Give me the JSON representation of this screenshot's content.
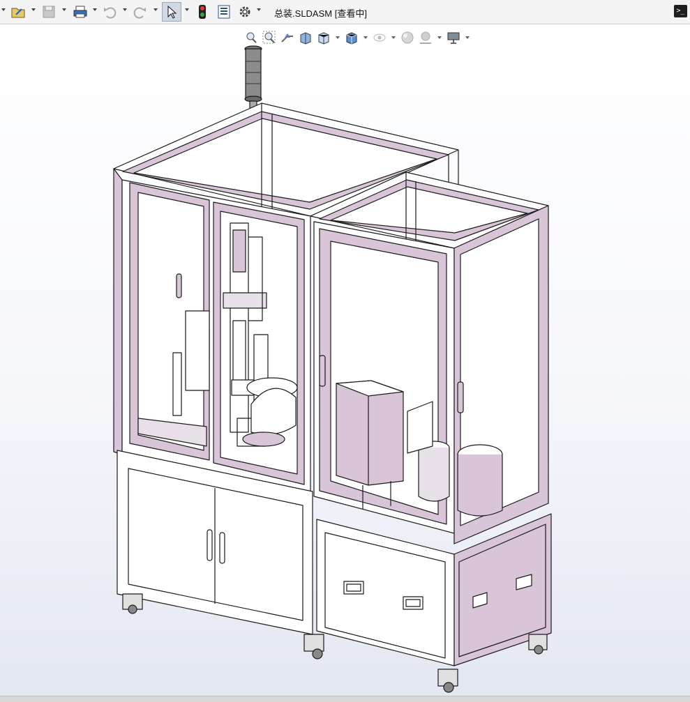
{
  "window": {
    "title": "总装.SLDASM [查看中]"
  },
  "toolbar": {
    "icons": [
      "menu-caret-icon",
      "open-icon",
      "save-icon",
      "print-icon",
      "undo-icon",
      "redo-icon",
      "select-arrow-icon",
      "traffic-light-icon",
      "options-list-icon",
      "gear-icon"
    ],
    "command_glyph": ">_"
  },
  "heads_up": {
    "icons": [
      "zoom-to-fit-icon",
      "zoom-to-area-icon",
      "previous-view-icon",
      "section-view-icon",
      "view-orientation-icon",
      "display-style-icon",
      "hide-show-icon",
      "appearance-icon",
      "scene-icon",
      "display-monitor-icon"
    ]
  },
  "colors": {
    "panel_fill": "#d8c6d8",
    "line": "#1a1a1a",
    "toolbar_bg": "#f4f4f4",
    "select_highlight": "#cfd8e3",
    "beacon": "#6a6a6a"
  },
  "model": {
    "name": "总装",
    "components": [
      "left-cabinet",
      "right-cabinet",
      "signal-tower",
      "rotary-table",
      "vertical-slide-module",
      "feeder-box",
      "vibratory-bowl",
      "cabinet-doors",
      "drawers",
      "casters"
    ]
  }
}
